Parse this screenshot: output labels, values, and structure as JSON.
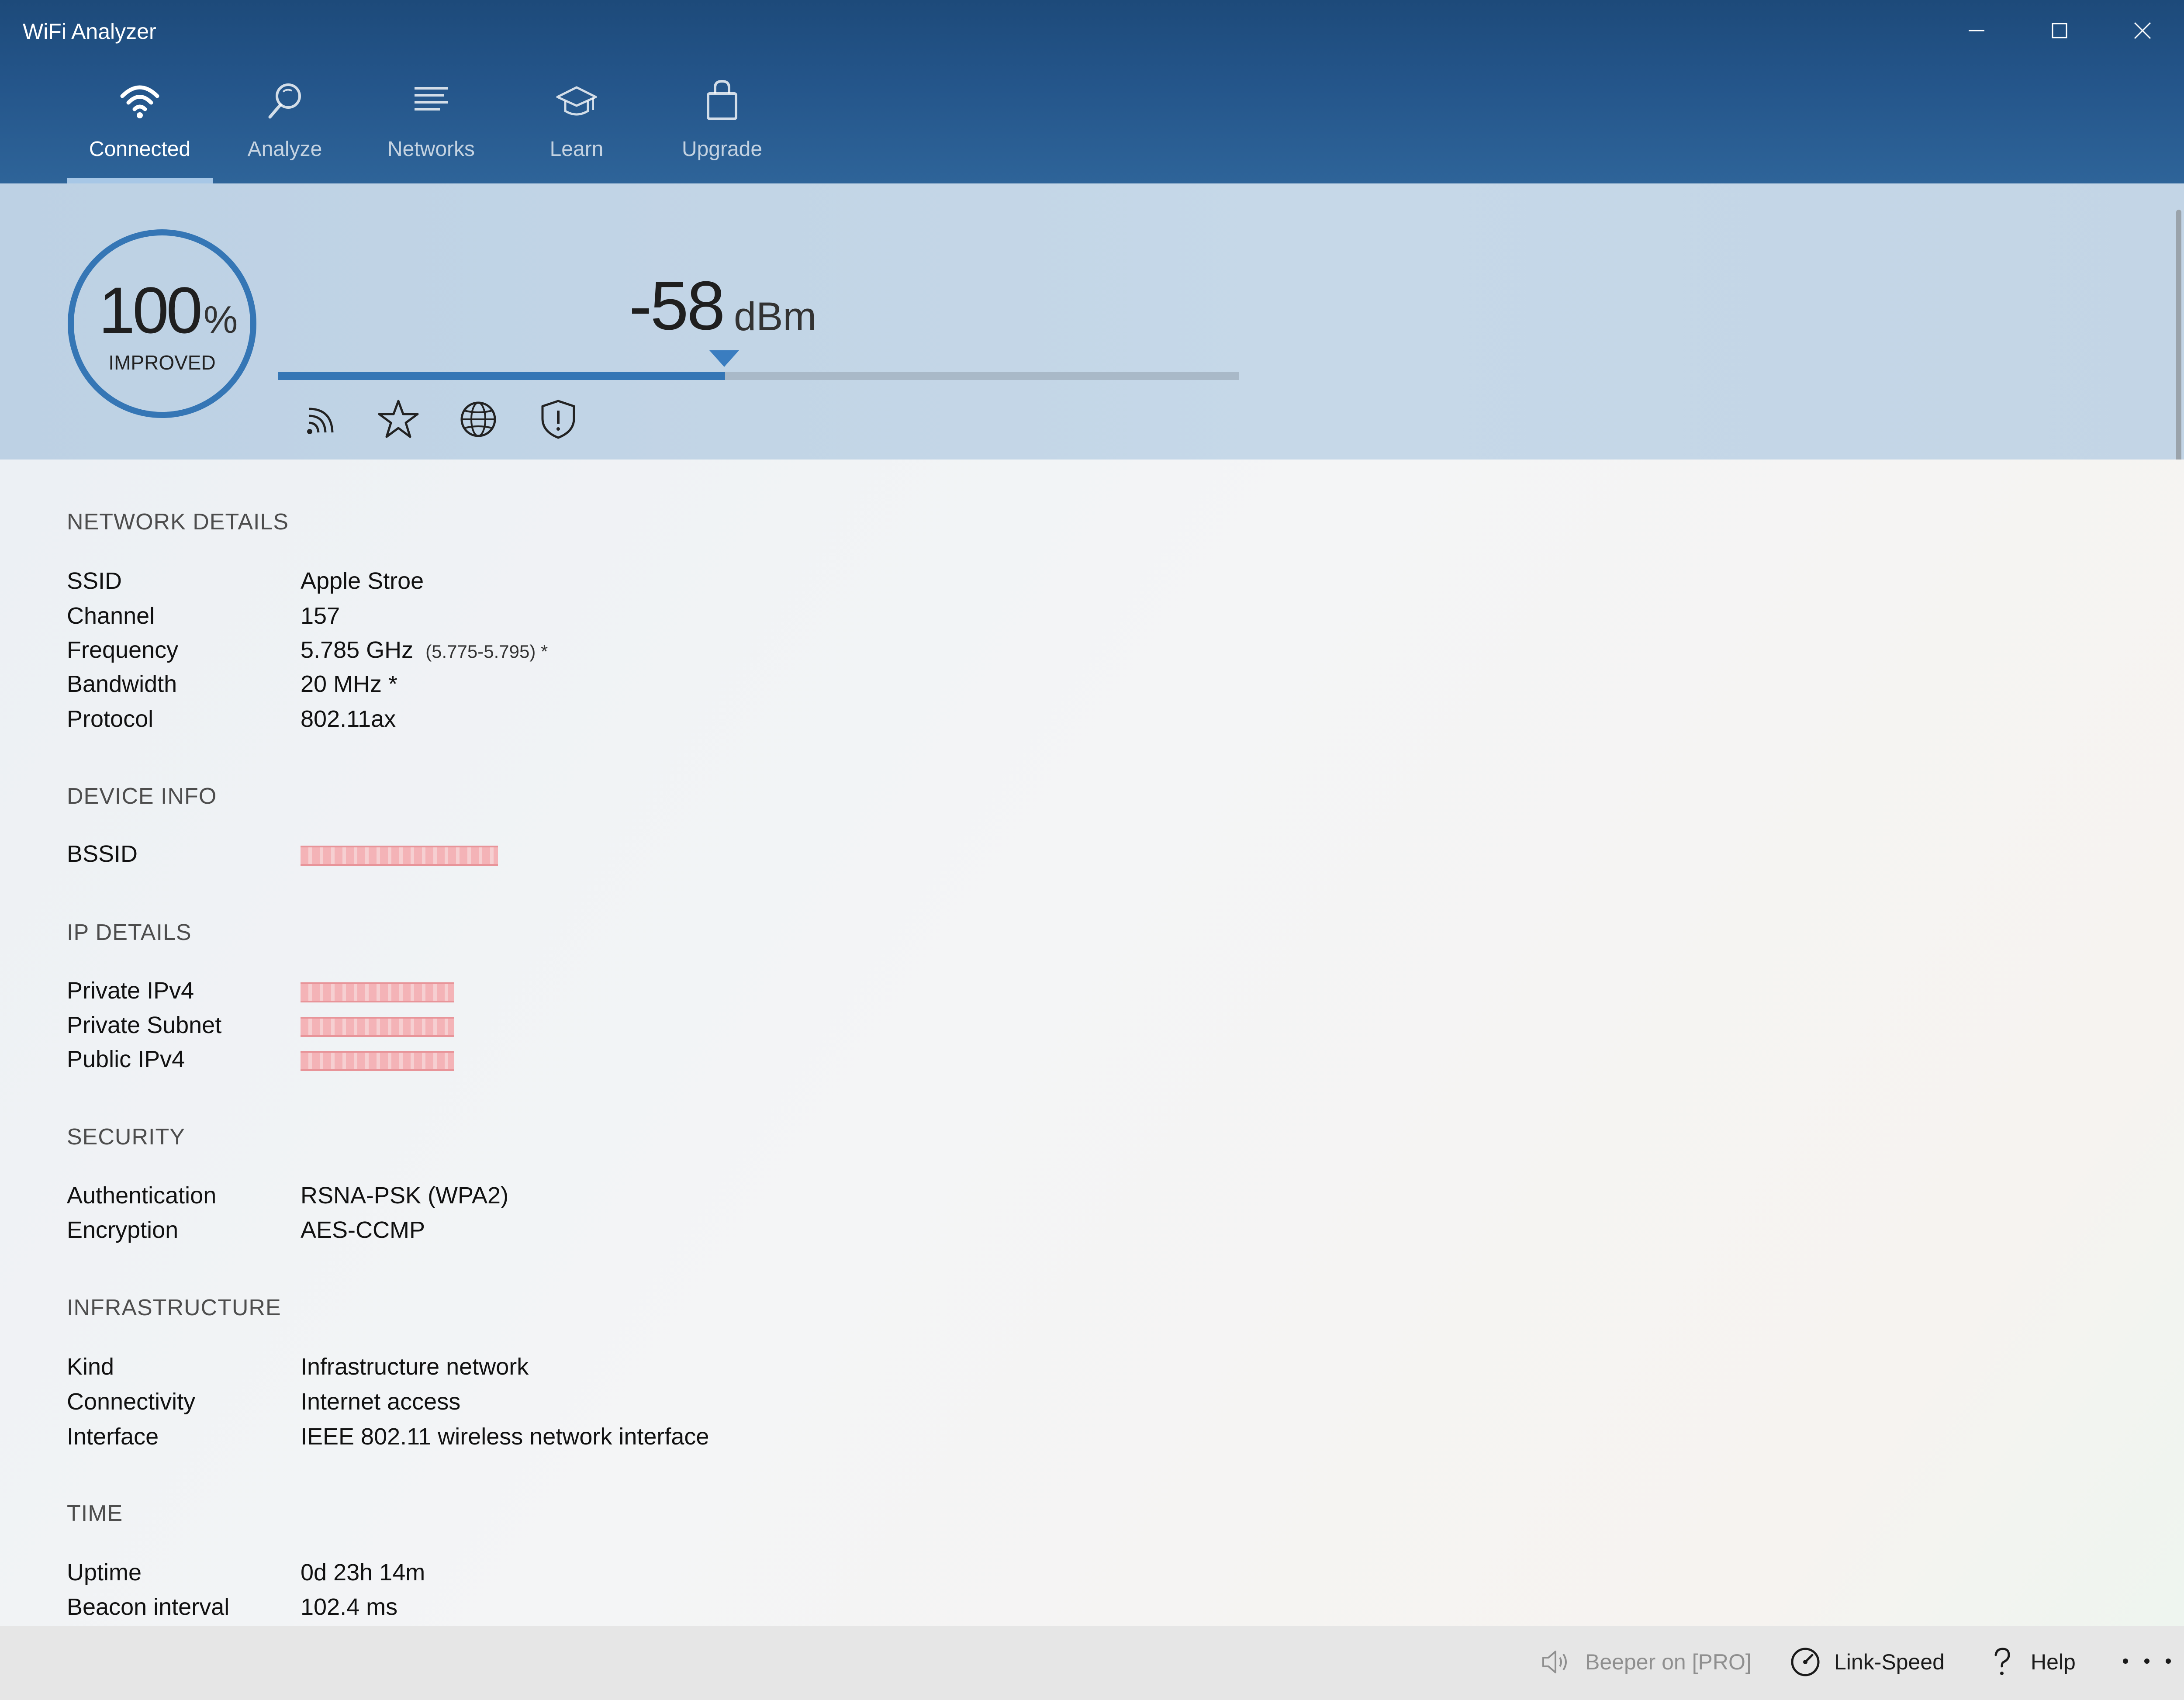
{
  "window": {
    "title": "WiFi Analyzer",
    "controls": [
      "minimize-icon",
      "maximize-icon",
      "close-icon"
    ]
  },
  "tabs": [
    {
      "label": "Connected",
      "icon": "wifi-icon",
      "active": true
    },
    {
      "label": "Analyze",
      "icon": "magnifier-icon",
      "active": false
    },
    {
      "label": "Networks",
      "icon": "list-icon",
      "active": false
    },
    {
      "label": "Learn",
      "icon": "graduation-cap-icon",
      "active": false
    },
    {
      "label": "Upgrade",
      "icon": "shopping-bag-icon",
      "active": false
    }
  ],
  "signal": {
    "score": "100",
    "score_unit": "%",
    "score_label": "IMPROVED",
    "dbm": "-58",
    "dbm_unit": "dBm",
    "bar_fraction": 0.465,
    "icons": [
      "signal-strength-icon",
      "star-icon",
      "globe-icon",
      "shield-icon"
    ]
  },
  "sections": {
    "network": {
      "title": "NETWORK DETAILS",
      "rows": [
        {
          "label": "SSID",
          "value": "Apple Stroe"
        },
        {
          "label": "Channel",
          "value": "157"
        },
        {
          "label": "Frequency",
          "value": "5.785 GHz",
          "note": "(5.775-5.795) *"
        },
        {
          "label": "Bandwidth",
          "value": "20 MHz *"
        },
        {
          "label": "Protocol",
          "value": "802.11ax"
        }
      ]
    },
    "device": {
      "title": "DEVICE INFO",
      "rows": [
        {
          "label": "BSSID",
          "value": "",
          "redacted": true
        }
      ]
    },
    "ip": {
      "title": "IP DETAILS",
      "rows": [
        {
          "label": "Private IPv4",
          "value": "",
          "redacted": true
        },
        {
          "label": "Private Subnet",
          "value": "",
          "redacted": true
        },
        {
          "label": "Public IPv4",
          "value": "",
          "redacted": true
        }
      ]
    },
    "security": {
      "title": "SECURITY",
      "rows": [
        {
          "label": "Authentication",
          "value": "RSNA-PSK (WPA2)"
        },
        {
          "label": "Encryption",
          "value": "AES-CCMP"
        }
      ]
    },
    "infrastructure": {
      "title": "INFRASTRUCTURE",
      "rows": [
        {
          "label": "Kind",
          "value": "Infrastructure network"
        },
        {
          "label": "Connectivity",
          "value": "Internet access"
        },
        {
          "label": "Interface",
          "value": "IEEE 802.11 wireless network interface"
        }
      ]
    },
    "time": {
      "title": "TIME",
      "rows": [
        {
          "label": "Uptime",
          "value": "0d 23h 14m"
        },
        {
          "label": "Beacon interval",
          "value": "102.4 ms"
        }
      ]
    }
  },
  "commandbar": {
    "beeper": {
      "label": "Beeper on [PRO]",
      "icon": "speaker-icon",
      "disabled": true
    },
    "linkspeed": {
      "label": "Link-Speed",
      "icon": "speedometer-icon"
    },
    "help": {
      "label": "Help",
      "icon": "question-icon"
    },
    "more": {
      "icon": "more-icon"
    }
  },
  "colors": {
    "header": "#24558a",
    "accent": "#3576b5",
    "panel": "#c3d5e6",
    "redaction": "#f5a9ad"
  }
}
